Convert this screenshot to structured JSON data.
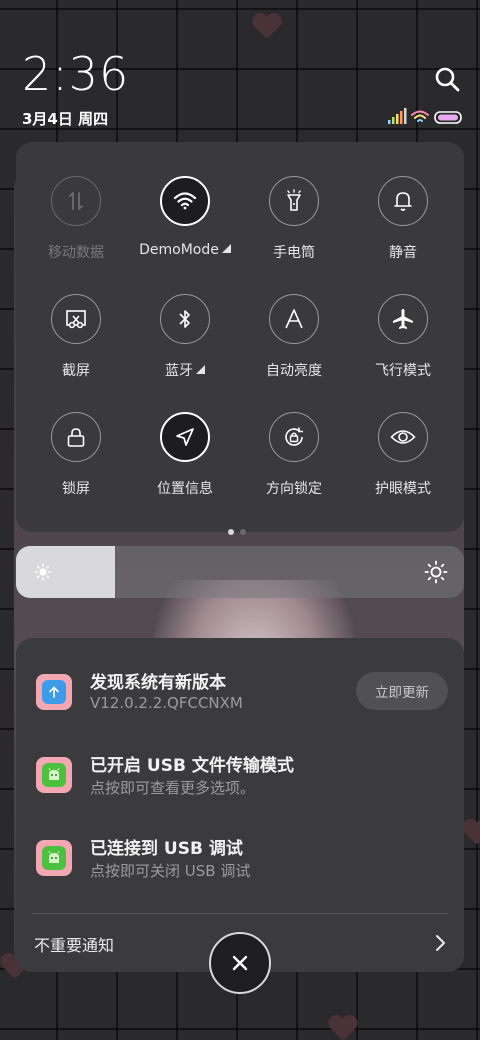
{
  "status": {
    "time": "2:36",
    "date": "3月4日 周四"
  },
  "header": {
    "search_icon": "search-icon"
  },
  "quick_settings": {
    "tiles": [
      {
        "label": "移动数据",
        "icon": "mobile-data-icon",
        "state": "disabled"
      },
      {
        "label": "DemoMode",
        "icon": "wifi-icon",
        "state": "active"
      },
      {
        "label": "手电筒",
        "icon": "flashlight-icon",
        "state": "off"
      },
      {
        "label": "静音",
        "icon": "bell-icon",
        "state": "off"
      },
      {
        "label": "截屏",
        "icon": "screenshot-icon",
        "state": "off"
      },
      {
        "label": "蓝牙",
        "icon": "bluetooth-icon",
        "state": "off"
      },
      {
        "label": "自动亮度",
        "icon": "auto-brightness-icon",
        "state": "off"
      },
      {
        "label": "飞行模式",
        "icon": "airplane-icon",
        "state": "off"
      },
      {
        "label": "锁屏",
        "icon": "lock-icon",
        "state": "off"
      },
      {
        "label": "位置信息",
        "icon": "location-icon",
        "state": "active"
      },
      {
        "label": "方向锁定",
        "icon": "rotation-lock-icon",
        "state": "off"
      },
      {
        "label": "护眼模式",
        "icon": "eye-icon",
        "state": "off"
      }
    ],
    "page_count": 2,
    "current_page": 1
  },
  "brightness": {
    "level": 0.22
  },
  "notifications": [
    {
      "title": "发现系统有新版本",
      "subtitle": "V12.0.2.2.QFCCNXM",
      "action": "立即更新",
      "icon": "system-update-icon",
      "icon_color": "#3d9be9"
    },
    {
      "title": "已开启 USB 文件传输模式",
      "subtitle": "点按即可查看更多选项。",
      "icon": "android-icon",
      "icon_color": "#4cc13f"
    },
    {
      "title": "已连接到 USB 调试",
      "subtitle": "点按即可关闭 USB 调试",
      "icon": "android-icon",
      "icon_color": "#4cc13f"
    }
  ],
  "footer": {
    "unimportant_label": "不重要通知"
  },
  "colors": {
    "panel": "#3a3a3c",
    "accent_pink": "#f2a7b3"
  }
}
